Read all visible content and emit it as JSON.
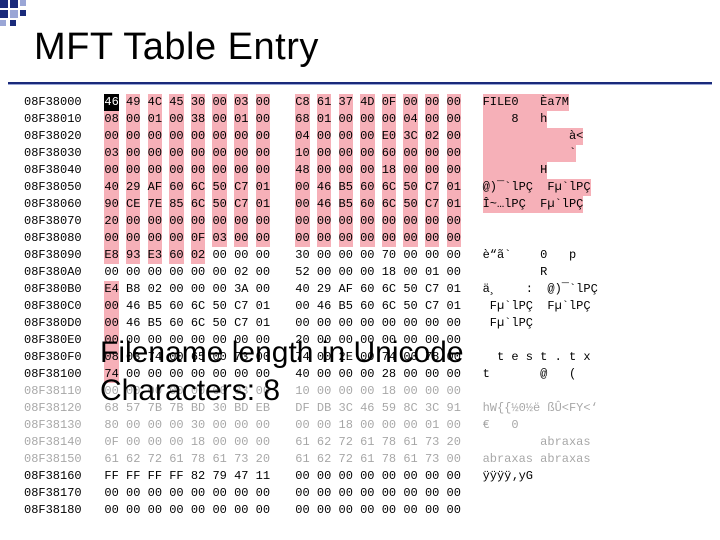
{
  "title": "MFT Table Entry",
  "overlay": {
    "line1": "Filename length in Unicode",
    "line2": "Characters: 8"
  },
  "columns": [
    "address",
    "hex_group_a",
    "hex_group_b",
    "ascii"
  ],
  "rows": [
    {
      "addr": "08F38000",
      "a": "46 49 4C 45 30 00 03 00",
      "b": "C8 61 37 4D 0F 00 00 00",
      "asc": "FILE0   Èa7M"
    },
    {
      "addr": "08F38010",
      "a": "08 00 01 00 38 00 01 00",
      "b": "68 01 00 00 00 04 00 00",
      "asc": "    8   h"
    },
    {
      "addr": "08F38020",
      "a": "00 00 00 00 00 00 00 00",
      "b": "04 00 00 00 E0 3C 02 00",
      "asc": "            à<"
    },
    {
      "addr": "08F38030",
      "a": "03 00 00 00 00 00 00 00",
      "b": "10 00 00 00 60 00 00 00",
      "asc": "            `"
    },
    {
      "addr": "08F38040",
      "a": "00 00 00 00 00 00 00 00",
      "b": "48 00 00 00 18 00 00 00",
      "asc": "        H"
    },
    {
      "addr": "08F38050",
      "a": "40 29 AF 60 6C 50 C7 01",
      "b": "00 46 B5 60 6C 50 C7 01",
      "asc": "@)¯`lPÇ  Fµ`lPÇ"
    },
    {
      "addr": "08F38060",
      "a": "90 CE 7E 85 6C 50 C7 01",
      "b": "00 46 B5 60 6C 50 C7 01",
      "asc": "Î~…lPÇ  Fµ`lPÇ"
    },
    {
      "addr": "08F38070",
      "a": "20 00 00 00 00 00 00 00",
      "b": "00 00 00 00 00 00 00 00",
      "asc": ""
    },
    {
      "addr": "08F38080",
      "a": "00 00 00 00 0F 03 00 00",
      "b": "00 00 00 00 00 00 00 00",
      "asc": ""
    },
    {
      "addr": "08F38090",
      "a": "E8 93 E3 60 02 00 00 00",
      "b": "30 00 00 00 70 00 00 00",
      "asc": "è“ã`    0   p"
    },
    {
      "addr": "08F380A0",
      "a": "00 00 00 00 00 00 02 00",
      "b": "52 00 00 00 18 00 01 00",
      "asc": "        R"
    },
    {
      "addr": "08F380B0",
      "a": "E4 B8 02 00 00 00 3A 00",
      "b": "40 29 AF 60 6C 50 C7 01",
      "asc": "ä¸    :  @)¯`lPÇ"
    },
    {
      "addr": "08F380C0",
      "a": "00 46 B5 60 6C 50 C7 01",
      "b": "00 46 B5 60 6C 50 C7 01",
      "asc": " Fµ`lPÇ  Fµ`lPÇ"
    },
    {
      "addr": "08F380D0",
      "a": "00 46 B5 60 6C 50 C7 01",
      "b": "00 00 00 00 00 00 00 00",
      "asc": " Fµ`lPÇ"
    },
    {
      "addr": "08F380E0",
      "a": "00 00 00 00 00 00 00 00",
      "b": "20 00 00 00 00 00 00 00",
      "asc": ""
    },
    {
      "addr": "08F380F0",
      "a": "08 03 74 00 65 00 73 00",
      "b": "74 00 2E 00 74 00 78 00",
      "asc": "  t e s t . t x"
    },
    {
      "addr": "08F38100",
      "a": "74 00 00 00 00 00 00 00",
      "b": "40 00 00 00 28 00 00 00",
      "asc": "t       @   ("
    },
    {
      "addr": "08F38110",
      "a": "00 00 00 00 00 00 03 00",
      "b": "10 00 00 00 18 00 00 00",
      "asc": ""
    },
    {
      "addr": "08F38120",
      "a": "68 57 7B 7B BD 30 BD EB",
      "b": "DF DB 3C 46 59 8C 3C 91",
      "asc": "hW{{½0½ë ßÛ<FY<‘"
    },
    {
      "addr": "08F38130",
      "a": "80 00 00 00 30 00 00 00",
      "b": "00 00 18 00 00 00 01 00",
      "asc": "€   0"
    },
    {
      "addr": "08F38140",
      "a": "0F 00 00 00 18 00 00 00",
      "b": "61 62 72 61 78 61 73 20",
      "asc": "        abraxas "
    },
    {
      "addr": "08F38150",
      "a": "61 62 72 61 78 61 73 20",
      "b": "61 62 72 61 78 61 73 00",
      "asc": "abraxas abraxas"
    },
    {
      "addr": "08F38160",
      "a": "FF FF FF FF 82 79 47 11",
      "b": "00 00 00 00 00 00 00 00",
      "asc": "ÿÿÿÿ‚yG"
    },
    {
      "addr": "08F38170",
      "a": "00 00 00 00 00 00 00 00",
      "b": "00 00 00 00 00 00 00 00",
      "asc": ""
    },
    {
      "addr": "08F38180",
      "a": "00 00 00 00 00 00 00 00",
      "b": "00 00 00 00 00 00 00 00",
      "asc": ""
    }
  ],
  "highlight_rows": [
    "08F38000",
    "08F38010",
    "08F38020",
    "08F38030",
    "08F38040",
    "08F38050",
    "08F38060",
    "08F38070",
    "08F38080"
  ],
  "partial_highlight": {
    "addr": "08F38090",
    "chars_a": 5
  },
  "vertical_highlight_addrs": [
    "08F380B0",
    "08F380C0",
    "08F380D0",
    "08F380E0",
    "08F380F0",
    "08F38100"
  ],
  "cursor": {
    "addr": "08F38000",
    "col": 0
  }
}
